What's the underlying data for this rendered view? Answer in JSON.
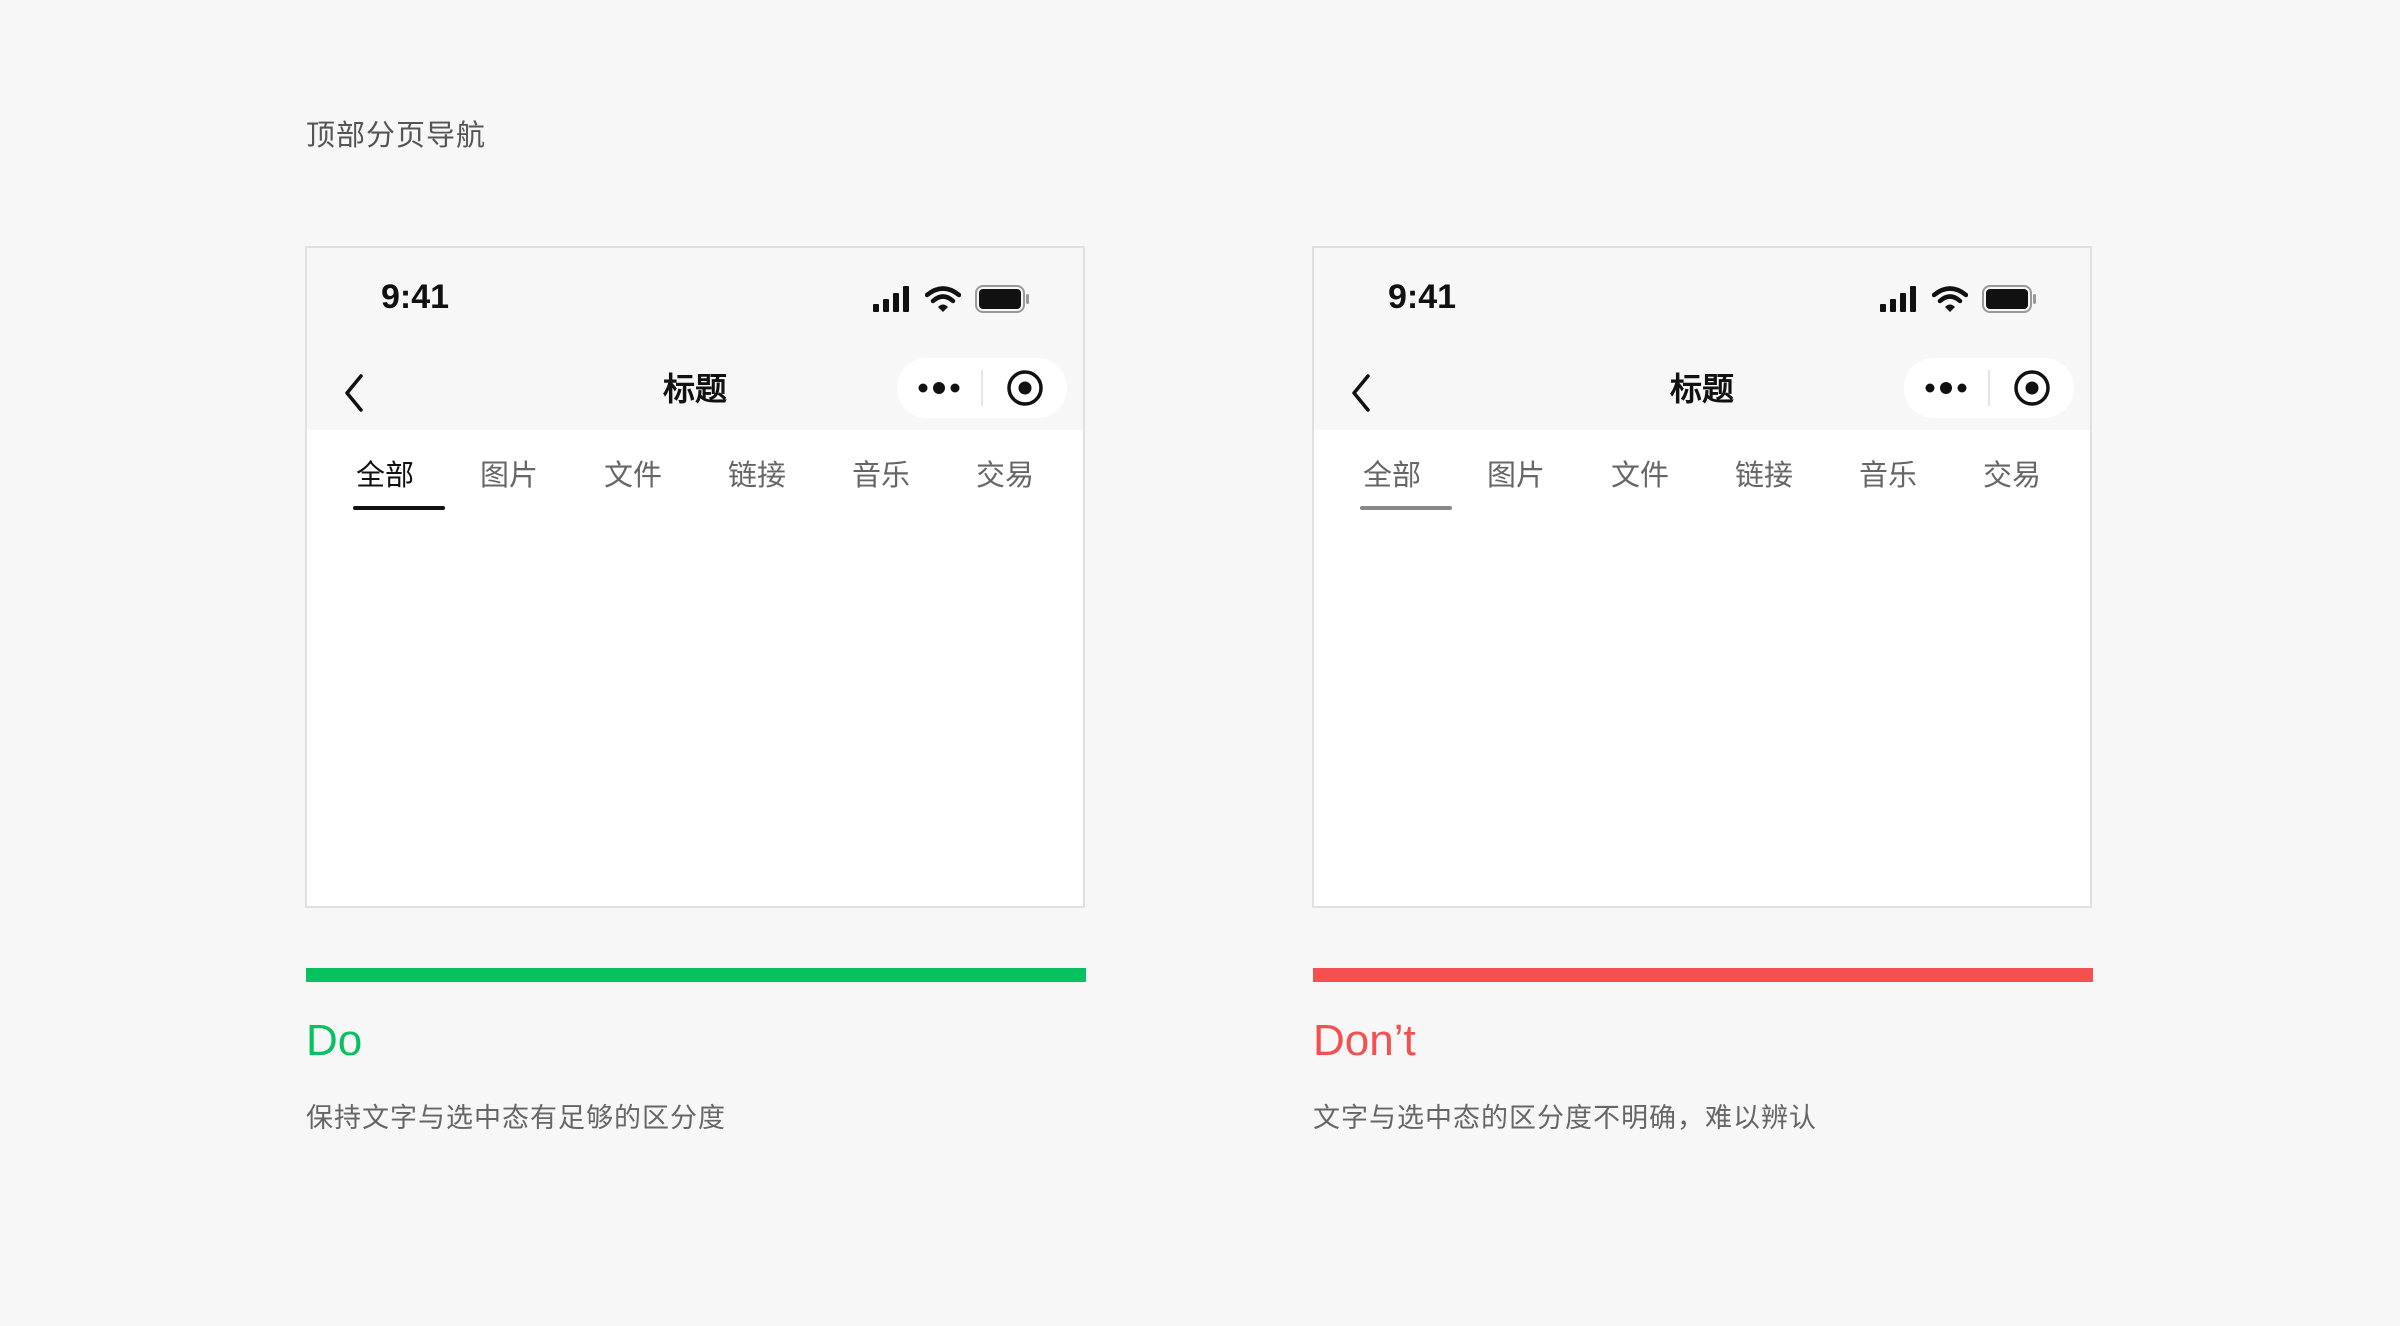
{
  "section_title": "顶部分页导航",
  "examples": [
    {
      "status_time": "9:41",
      "nav_title": "标题",
      "tabs": [
        "全部",
        "图片",
        "文件",
        "链接",
        "音乐",
        "交易"
      ],
      "active_tab": 0,
      "underline_color": "#111111",
      "verdict": "Do",
      "verdict_color": "#07c160",
      "description": "保持文字与选中态有足够的区分度"
    },
    {
      "status_time": "9:41",
      "nav_title": "标题",
      "tabs": [
        "全部",
        "图片",
        "文件",
        "链接",
        "音乐",
        "交易"
      ],
      "active_tab": 0,
      "underline_color": "#888888",
      "verdict": "Don’t",
      "verdict_color": "#f55050",
      "description": "文字与选中态的区分度不明确，难以辨认"
    }
  ],
  "icons": {
    "signal": "signal-icon",
    "wifi": "wifi-icon",
    "battery": "battery-icon",
    "back": "chevron-left-icon",
    "more": "more-icon",
    "close": "target-icon"
  }
}
